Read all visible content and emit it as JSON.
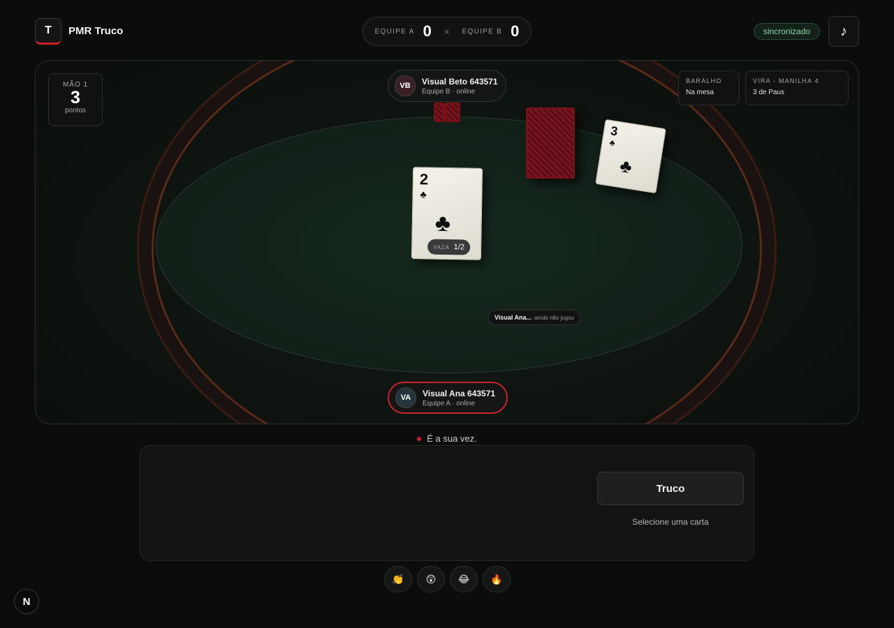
{
  "app": {
    "logo_letter": "T",
    "title": "PMR Truco"
  },
  "scoreboard": {
    "team_a_label": "EQUIPE A",
    "team_a_score": "0",
    "separator": "×",
    "team_b_label": "EQUIPE B",
    "team_b_score": "0"
  },
  "header": {
    "sync_status": "sincronizado",
    "music_icon": "♪"
  },
  "table": {
    "hand": {
      "label": "MÃO 1",
      "value": "3",
      "unit": "pontos"
    },
    "deck": {
      "label": "BARALHO",
      "value": "Na mesa"
    },
    "vira": {
      "label": "VIRA - MANILHA 4",
      "value": "3 de Paus"
    },
    "opponent": {
      "initials": "VB",
      "name": "Visual Beto 643571",
      "team": "Equipe B · online"
    },
    "me": {
      "initials": "VA",
      "name": "Visual Ana 643571",
      "team": "Equipe A · online"
    },
    "played_card": {
      "rank": "2",
      "suit": "♣"
    },
    "vira_card": {
      "rank": "3",
      "suit": "♣"
    },
    "trick": {
      "label": "VAZA",
      "value": "1/2"
    },
    "status_chip": {
      "name": "Visual Ana...",
      "text": "ainda não jogou"
    }
  },
  "turn": {
    "text": "É a sua vez."
  },
  "actions": {
    "truco_label": "Truco",
    "hint": "Selecione uma carta"
  },
  "emojis": [
    "👏",
    "😲",
    "😂",
    "🔥"
  ],
  "footer": {
    "badge": "N"
  },
  "colors": {
    "accent_red": "#d11d28",
    "sync_green": "#8ed6a8",
    "felt": "#122119"
  }
}
